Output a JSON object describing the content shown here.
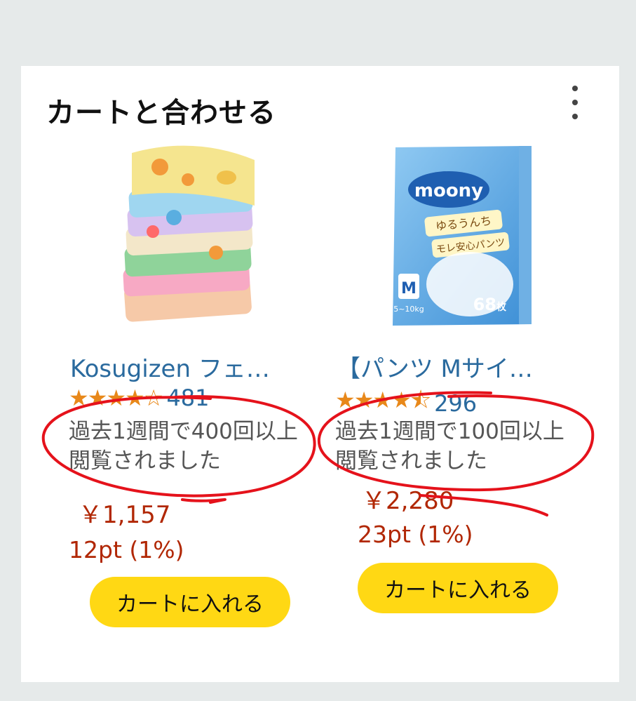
{
  "section": {
    "title": "カートと合わせる"
  },
  "products": [
    {
      "name": "Kosugizen フェ…",
      "stars": "★★★★☆",
      "review_count": "481",
      "viewed_text": "過去1週間で400回以上閲覧されました",
      "price": "￥1,157",
      "points": "12pt (1%)",
      "cart_button": "カートに入れる"
    },
    {
      "name": "【パンツ Mサイ…",
      "stars": "★★★★⯪",
      "review_count": "296",
      "viewed_text": "過去1週間で100回以上閲覧されました",
      "price": "￥2,280",
      "points": "23pt (1%)",
      "cart_button": "カートに入れる",
      "package": {
        "brand": "moony",
        "subtitle_1": "ゆるうんち",
        "subtitle_2": "モレ安心パンツ",
        "size": "M",
        "weight": "5~10kg",
        "count": "68",
        "count_unit": "枚"
      }
    }
  ],
  "colors": {
    "link": "#2a6a9e",
    "price": "#b12704",
    "button": "#ffd814",
    "annotation": "#e5121b"
  },
  "icons": {
    "menu": "more-vertical-icon"
  }
}
